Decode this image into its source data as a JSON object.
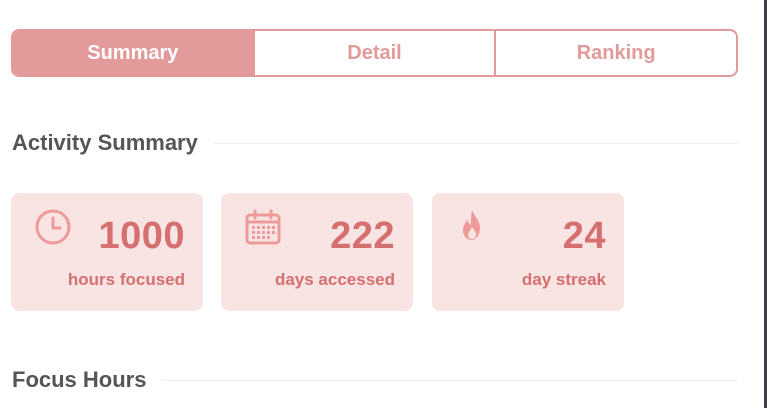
{
  "tabs": [
    {
      "label": "Summary",
      "active": true
    },
    {
      "label": "Detail",
      "active": false
    },
    {
      "label": "Ranking",
      "active": false
    }
  ],
  "sections": {
    "activity_title": "Activity Summary",
    "focus_title": "Focus Hours"
  },
  "stats": [
    {
      "icon": "clock-icon",
      "value": "1000",
      "label": "hours focused"
    },
    {
      "icon": "calendar-icon",
      "value": "222",
      "label": "days accessed"
    },
    {
      "icon": "flame-icon",
      "value": "24",
      "label": "day streak"
    }
  ],
  "colors": {
    "accent": "#e39a9a",
    "card_bg": "#f9e4e4",
    "stat_text": "#d66f6f",
    "heading": "#555555"
  }
}
